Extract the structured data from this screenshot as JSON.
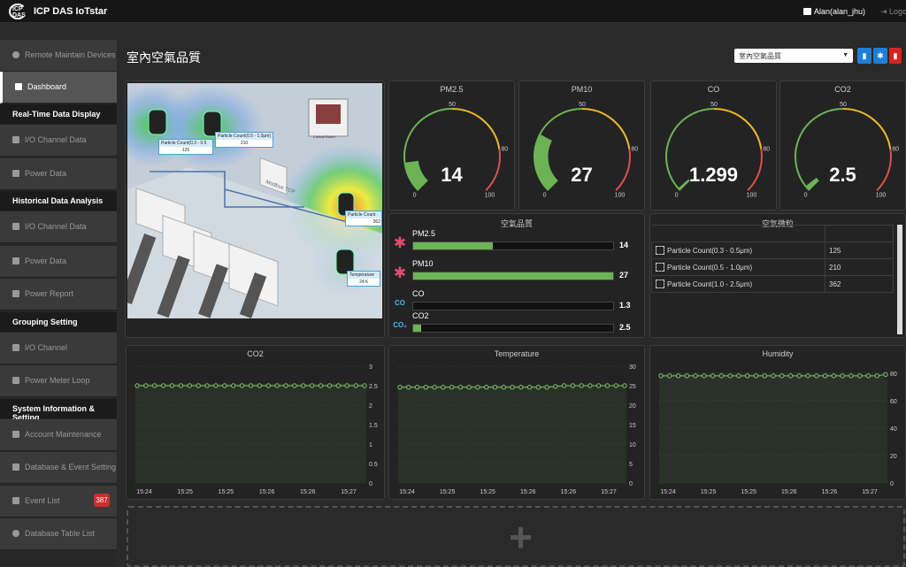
{
  "app": {
    "logo_text": "ICP DAS",
    "title": "ICP DAS IoTstar",
    "user": "Alan(alan_jhu)",
    "logout": "Logout"
  },
  "sidebar": {
    "items": [
      {
        "label": "Remote Maintain Devices",
        "icon": "cloud-icon"
      },
      {
        "label": "Dashboard",
        "icon": "dashboard-icon"
      },
      {
        "header": "Real-Time Data Display"
      },
      {
        "label": "I/O Channel Data",
        "icon": "square-icon"
      },
      {
        "label": "Power Data",
        "icon": "square-icon"
      },
      {
        "header": "Historical Data Analysis"
      },
      {
        "label": "I/O Channel Data",
        "icon": "square-icon"
      },
      {
        "label": "Power Data",
        "icon": "square-icon"
      },
      {
        "label": "Power Report",
        "icon": "file-icon"
      },
      {
        "header": "Grouping Setting"
      },
      {
        "label": "I/O Channel",
        "icon": "list-icon"
      },
      {
        "label": "Power Meter Loop",
        "icon": "list-icon"
      },
      {
        "header": "System Information & Setting"
      },
      {
        "label": "Account Maintenance",
        "icon": "gear-icon"
      },
      {
        "label": "Database & Event Setting",
        "icon": "gear-icon"
      },
      {
        "label": "Event List",
        "icon": "bell-icon",
        "badge": "387"
      },
      {
        "label": "Database Table List",
        "icon": "info-icon"
      }
    ]
  },
  "page": {
    "title": "室內空氣品質",
    "select_value": "室內空氣品質"
  },
  "floorplan": {
    "labels": [
      {
        "title": "Particle Count(0.3 - 0.5",
        "value": "125"
      },
      {
        "title": "Particle Count(0.5 - 1.0μm)",
        "value": "210"
      },
      {
        "title": "Particle Count",
        "value": "362"
      },
      {
        "title": "Temperature",
        "value": "24.6"
      }
    ],
    "control_room": "Control Room",
    "modbus": "Modbus TCP"
  },
  "gauges": [
    {
      "title": "PM2.5",
      "value": "14",
      "num": 14
    },
    {
      "title": "PM10",
      "value": "27",
      "num": 27
    },
    {
      "title": "CO",
      "value": "1.299",
      "num": 1.299
    },
    {
      "title": "CO2",
      "value": "2.5",
      "num": 2.5
    }
  ],
  "gauge_scale": {
    "min": "0",
    "mid": "50",
    "high": "80",
    "max": "100"
  },
  "air_quality": {
    "title": "空氣品質",
    "rows": [
      {
        "name": "PM2.5",
        "value": "14",
        "fraction": 0.4,
        "icon": "particle-icon"
      },
      {
        "name": "PM10",
        "value": "27",
        "fraction": 1.0,
        "icon": "particle-icon"
      },
      {
        "name": "CO",
        "value": "1.3",
        "fraction": 0.0,
        "icon": "co-cloud-icon"
      },
      {
        "name": "CO2",
        "value": "2.5",
        "fraction": 0.04,
        "icon": "co2-cloud-icon"
      }
    ]
  },
  "particles": {
    "title": "空氣微粒",
    "rows": [
      {
        "name": "Particle Count(0.3 - 0.5μm)",
        "value": "125"
      },
      {
        "name": "Particle Count(0.5 - 1.0μm)",
        "value": "210"
      },
      {
        "name": "Particle Count(1.0 - 2.5μm)",
        "value": "362"
      }
    ]
  },
  "chart_data": [
    {
      "type": "line",
      "title": "CO2",
      "x": [
        "15:24",
        "15:25",
        "15:25",
        "15:26",
        "15:26",
        "15:27"
      ],
      "yticks": [
        "0",
        "0.5",
        "1",
        "1.5",
        "2",
        "2.5",
        "3"
      ],
      "ylim": [
        0,
        3
      ],
      "y_axis": "right",
      "series": [
        {
          "values": [
            2.5,
            2.5,
            2.5,
            2.5,
            2.5,
            2.5,
            2.5,
            2.5,
            2.5,
            2.5,
            2.5,
            2.5,
            2.5,
            2.5,
            2.5,
            2.5,
            2.5,
            2.5,
            2.5,
            2.5,
            2.5,
            2.5,
            2.5,
            2.5,
            2.5,
            2.5,
            2.5
          ]
        }
      ]
    },
    {
      "type": "line",
      "title": "Temperature",
      "x": [
        "15:24",
        "15:25",
        "15:25",
        "15:26",
        "15:26",
        "15:27"
      ],
      "yticks": [
        "0",
        "5",
        "10",
        "15",
        "20",
        "25",
        "30"
      ],
      "ylim": [
        0,
        30
      ],
      "y_axis": "right",
      "series": [
        {
          "values": [
            24.6,
            24.6,
            24.6,
            24.6,
            24.6,
            24.6,
            24.6,
            24.6,
            24.6,
            24.6,
            24.6,
            24.6,
            24.6,
            24.6,
            24.6,
            24.6,
            24.6,
            24.6,
            24.8,
            25.0,
            25.0,
            25.0,
            25.0,
            25.0,
            25.0,
            25.0,
            25.0
          ]
        }
      ]
    },
    {
      "type": "line",
      "title": "Humidity",
      "x": [
        "15:24",
        "15:25",
        "15:25",
        "15:26",
        "15:26",
        "15:27"
      ],
      "yticks": [
        "0",
        "20",
        "40",
        "60",
        "80"
      ],
      "ylim": [
        0,
        85
      ],
      "y_axis": "right",
      "series": [
        {
          "values": [
            78,
            78,
            78,
            78,
            78,
            78,
            78,
            78,
            78,
            78,
            78,
            78,
            78,
            78,
            78,
            78,
            78,
            78,
            78,
            78,
            78,
            78,
            78,
            78,
            78,
            78,
            79
          ]
        }
      ]
    }
  ],
  "colors": {
    "gauge_green": "#6cb356",
    "gauge_yellow": "#e8b72d",
    "gauge_red": "#d9534f",
    "line": "#7ec46a",
    "accent": "#1f7fd8",
    "danger": "#d9231f"
  }
}
